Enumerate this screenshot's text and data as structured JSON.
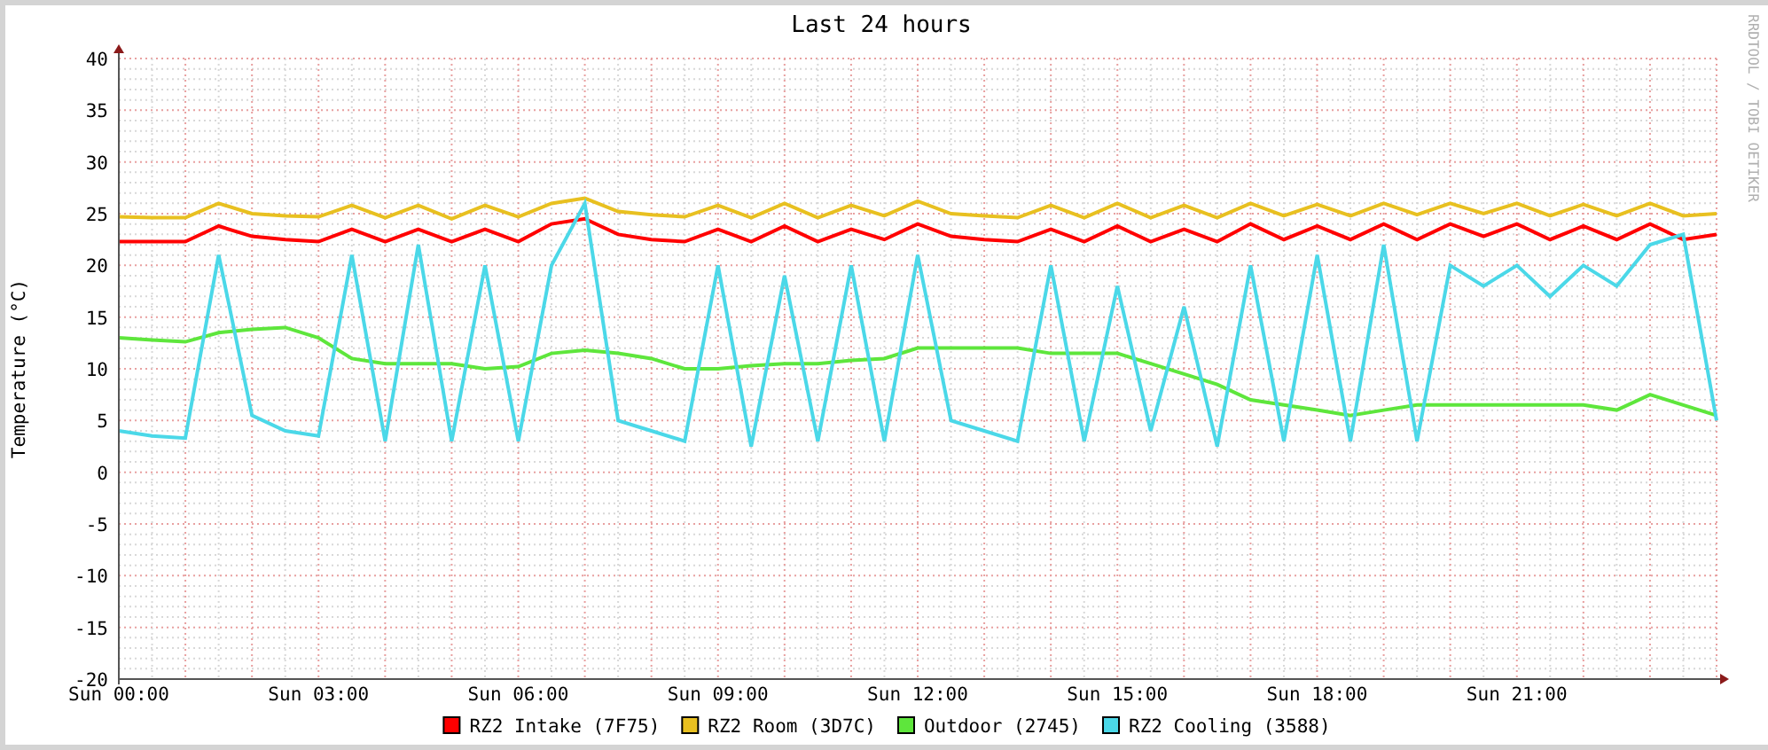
{
  "chart_data": {
    "type": "line",
    "title": "Last 24 hours",
    "ylabel": "Temperature (°C)",
    "categories": [
      "Sun 00:00",
      null,
      null,
      null,
      null,
      null,
      "Sun 03:00",
      null,
      null,
      null,
      null,
      null,
      "Sun 06:00",
      null,
      null,
      null,
      null,
      null,
      "Sun 09:00",
      null,
      null,
      null,
      null,
      null,
      "Sun 12:00",
      null,
      null,
      null,
      null,
      null,
      "Sun 15:00",
      null,
      null,
      null,
      null,
      null,
      "Sun 18:00",
      null,
      null,
      null,
      null,
      null,
      "Sun 21:00",
      null,
      null,
      null,
      null,
      null,
      null
    ],
    "series": [
      {
        "name": "RZ2 Intake (7F75)",
        "color": "#ff0000",
        "values": [
          22.3,
          22.3,
          22.3,
          23.8,
          22.8,
          22.5,
          22.3,
          23.5,
          22.3,
          23.5,
          22.3,
          23.5,
          22.3,
          24,
          24.5,
          23,
          22.5,
          22.3,
          23.5,
          22.3,
          23.8,
          22.3,
          23.5,
          22.5,
          24,
          22.8,
          22.5,
          22.3,
          23.5,
          22.3,
          23.8,
          22.3,
          23.5,
          22.3,
          24,
          22.5,
          23.8,
          22.5,
          24,
          22.5,
          24,
          22.8,
          24,
          22.5,
          23.8,
          22.5,
          24,
          22.5,
          23
        ]
      },
      {
        "name": "RZ2 Room (3D7C)",
        "color": "#e8c020",
        "values": [
          24.7,
          24.6,
          24.6,
          26,
          25,
          24.8,
          24.7,
          25.8,
          24.6,
          25.8,
          24.5,
          25.8,
          24.7,
          26,
          26.5,
          25.2,
          24.9,
          24.7,
          25.8,
          24.6,
          26,
          24.6,
          25.8,
          24.8,
          26.2,
          25,
          24.8,
          24.6,
          25.8,
          24.6,
          26,
          24.6,
          25.8,
          24.6,
          26,
          24.8,
          25.9,
          24.8,
          26,
          24.9,
          26,
          25,
          26,
          24.8,
          25.9,
          24.8,
          26,
          24.8,
          25
        ]
      },
      {
        "name": "Outdoor (2745)",
        "color": "#5ee63c",
        "values": [
          13,
          12.8,
          12.6,
          13.5,
          13.8,
          14,
          13,
          11,
          10.5,
          10.5,
          10.5,
          10,
          10.2,
          11.5,
          11.8,
          11.5,
          11,
          10,
          10,
          10.3,
          10.5,
          10.5,
          10.8,
          11,
          12,
          12,
          12,
          12,
          11.5,
          11.5,
          11.5,
          10.5,
          9.5,
          8.5,
          7,
          6.5,
          6,
          5.5,
          6,
          6.5,
          6.5,
          6.5,
          6.5,
          6.5,
          6.5,
          6,
          7.5,
          6.5,
          5.5
        ]
      },
      {
        "name": "RZ2 Cooling (3588)",
        "color": "#4bd8e8",
        "values": [
          4,
          3.5,
          3.3,
          21,
          5.5,
          4,
          3.5,
          21,
          3,
          22,
          3,
          20,
          3,
          20,
          26,
          5,
          4,
          3,
          20,
          2.5,
          19,
          3,
          20,
          3,
          21,
          5,
          4,
          3,
          20,
          3,
          18,
          4,
          16,
          2.5,
          20,
          3,
          21,
          3,
          22,
          3,
          20,
          18,
          20,
          17,
          20,
          18,
          22,
          23,
          5
        ]
      }
    ],
    "ylim": [
      -20,
      40
    ],
    "grid": true,
    "legend": "bottom",
    "yticks": [
      -20,
      -15,
      -10,
      -5,
      0,
      5,
      10,
      15,
      20,
      25,
      30,
      35,
      40
    ]
  },
  "credit": "RRDTOOL / TOBI OETIKER"
}
